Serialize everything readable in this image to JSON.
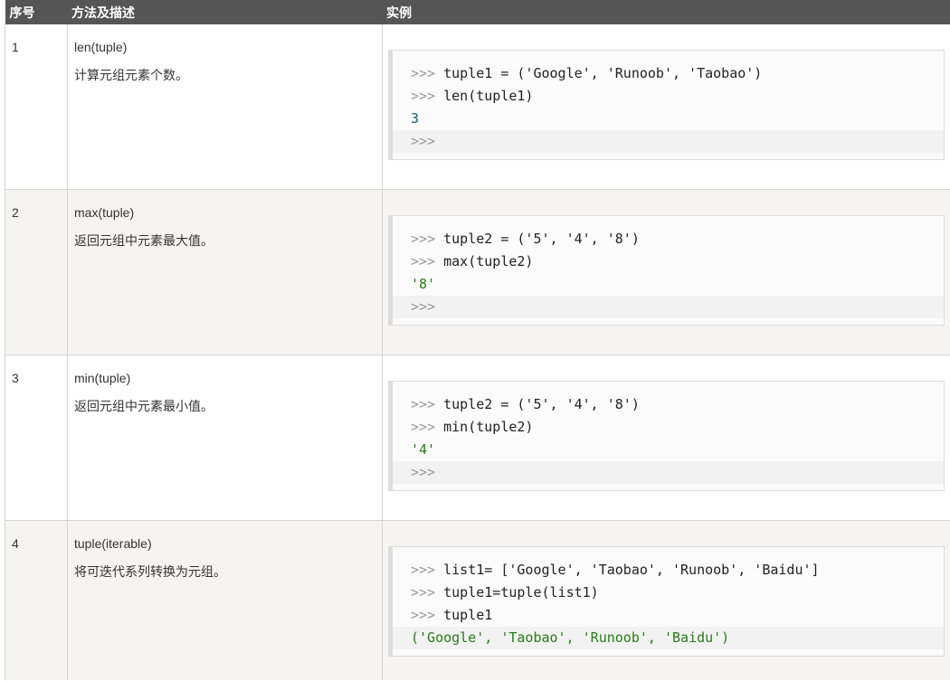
{
  "header": {
    "col_index": "序号",
    "col_method": "方法及描述",
    "col_example": "实例"
  },
  "rows": [
    {
      "index": "1",
      "method": "len(tuple)",
      "description": "计算元组元素个数。",
      "lines": [
        {
          "prompt": ">>> ",
          "text": "tuple1 = ('Google', 'Runoob', 'Taobao')"
        },
        {
          "prompt": ">>> ",
          "text": "len(tuple1)"
        },
        {
          "prompt": "",
          "text": "3"
        },
        {
          "prompt": ">>>",
          "text": ""
        }
      ]
    },
    {
      "index": "2",
      "method": "max(tuple)",
      "description": "返回元组中元素最大值。",
      "lines": [
        {
          "prompt": ">>> ",
          "text": "tuple2 = ('5', '4', '8')"
        },
        {
          "prompt": ">>> ",
          "text": "max(tuple2)"
        },
        {
          "prompt": "",
          "text": "'8'"
        },
        {
          "prompt": ">>>",
          "text": ""
        }
      ]
    },
    {
      "index": "3",
      "method": "min(tuple)",
      "description": "返回元组中元素最小值。",
      "lines": [
        {
          "prompt": ">>> ",
          "text": "tuple2 = ('5', '4', '8')"
        },
        {
          "prompt": ">>> ",
          "text": "min(tuple2)"
        },
        {
          "prompt": "",
          "text": "'4'"
        },
        {
          "prompt": ">>>",
          "text": ""
        }
      ]
    },
    {
      "index": "4",
      "method": "tuple(iterable)",
      "description": "将可迭代系列转换为元组。",
      "lines": [
        {
          "prompt": ">>> ",
          "text": "list1= ['Google', 'Taobao', 'Runoob', 'Baidu']"
        },
        {
          "prompt": ">>> ",
          "text": "tuple1=tuple(list1)"
        },
        {
          "prompt": ">>> ",
          "text": "tuple1"
        },
        {
          "prompt": "",
          "text": "('Google', 'Taobao', 'Runoob', 'Baidu')"
        }
      ]
    }
  ]
}
